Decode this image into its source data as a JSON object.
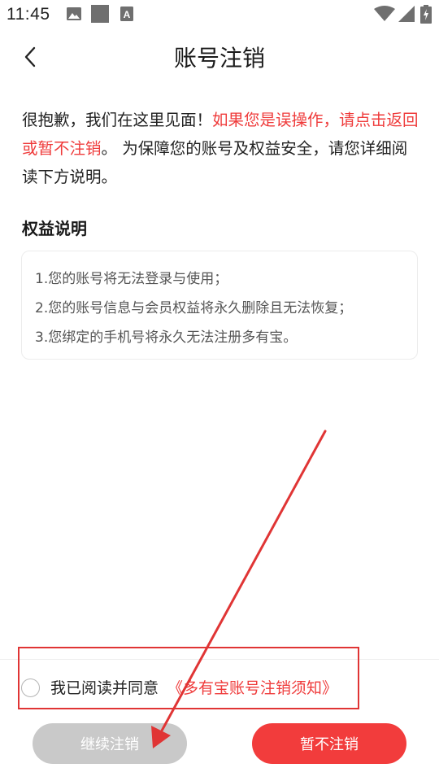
{
  "status_bar": {
    "time": "11:45",
    "icons": [
      "gallery-icon",
      "square-icon",
      "a-icon",
      "wifi-icon",
      "cell-signal-icon",
      "battery-charging-icon"
    ]
  },
  "header": {
    "back_icon": "chevron-left-icon",
    "title": "账号注销"
  },
  "intro": {
    "text_1": "很抱歉，我们在这里见面！",
    "text_red": "如果您是误操作，请点击返回或暂不注销",
    "text_2": "。 为保障您的账号及权益安全，请您详细阅读下方说明。"
  },
  "rights": {
    "title": "权益说明",
    "items": [
      "1.您的账号将无法登录与使用；",
      "2.您的账号信息与会员权益将永久删除且无法恢复；",
      "3.您绑定的手机号将永久无法注册多有宝。"
    ]
  },
  "agreement": {
    "text": "我已阅读并同意",
    "link": "《多有宝账号注销须知》",
    "checked": false
  },
  "buttons": {
    "continue_label": "继续注销",
    "cancel_label": "暂不注销"
  },
  "colors": {
    "accent_red": "#f23c3c",
    "disabled_gray": "#c9c9c9",
    "annotation_red": "#e03535"
  }
}
